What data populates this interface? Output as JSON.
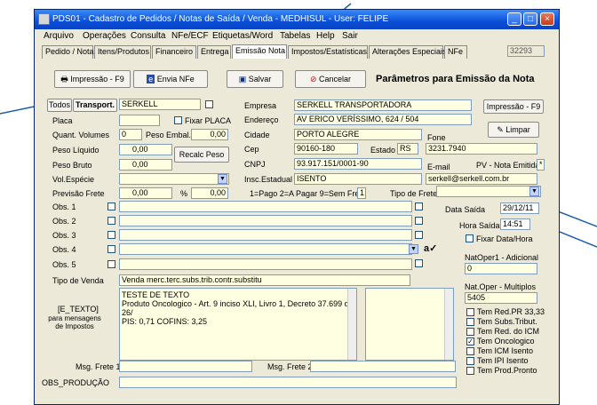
{
  "window": {
    "title": "PDS01 - Cadastro de Pedidos / Notas de Saída / Venda - MEDHISUL - User: FELIPE",
    "controls": {
      "minimize": "_",
      "maximize": "□",
      "close": "×"
    }
  },
  "menu": [
    "Arquivo",
    "Operações",
    "Consulta",
    "NFe/ECF",
    "Etiquetas/Word",
    "Tabelas",
    "Help",
    "Sair"
  ],
  "tabs": [
    "Pedido / Nota",
    "Itens/Produtos",
    "Financeiro",
    "Entrega",
    "Emissão Nota",
    "Impostos/Estatísticas",
    "Alterações Especiais",
    "NFe"
  ],
  "record_number": "32293",
  "toolbar": {
    "print": "Impressão - F9",
    "send_nfe": "Envia NFe",
    "save": "Salvar",
    "cancel": "Cancelar",
    "heading": "Parâmetros para Emissão da Nota"
  },
  "left": {
    "todos": "Todos",
    "transport": "Transport.",
    "transport_value": "SERKELL",
    "placa": "Placa",
    "fixar_placa": "Fixar PLACA",
    "quant_volumes": "Quant. Volumes",
    "quant_value": "0",
    "peso_embal": "Peso Embal.",
    "peso_embal_value": "0,00",
    "peso_liquido": "Peso Líquido",
    "peso_liquido_value": "0,00",
    "peso_bruto": "Peso Bruto",
    "peso_bruto_value": "0,00",
    "recalc": "Recalc Peso",
    "vol_especie": "Vol.Espécie",
    "previsao_frete": "Previsão Frete",
    "previsao_value": "0,00",
    "pct": "%",
    "pct_value": "0,00"
  },
  "company": {
    "empresa": "Empresa",
    "empresa_value": "SERKELL TRANSPORTADORA",
    "endereco": "Endereço",
    "endereco_value": "AV ERICO VERÍSSIMO, 624 / 504",
    "cidade": "Cidade",
    "cidade_value": "PORTO ALEGRE",
    "cep": "Cep",
    "cep_value": "90160-180",
    "estado": "Estado",
    "estado_value": "RS",
    "fone": "Fone",
    "fone_value": "3231.7940",
    "cnpj": "CNPJ",
    "cnpj_value": "93.917.151/0001-90",
    "email": "E-mail",
    "nota_emitida": "PV - Nota Emitida",
    "nota_emitida_value": "*",
    "insc": "Insc.Estadual",
    "insc_value": "ISENTO",
    "email_value": "serkell@serkell.com.br"
  },
  "right_top": {
    "print": "Impressão - F9",
    "clean": "Limpar"
  },
  "frete": {
    "legend": "1=Pago  2=A Pagar  9=Sem Frete",
    "value": "1",
    "tipo_label": "Tipo de Frete"
  },
  "obs": [
    "Obs. 1",
    "Obs. 2",
    "Obs. 3",
    "Obs. 4",
    "Obs. 5"
  ],
  "dates": {
    "data_saida": "Data Saída",
    "data_value": "29/12/11",
    "hora_saida": "Hora Saída",
    "hora_value": "14:51",
    "fixar": "Fixar Data/Hora"
  },
  "natoper": {
    "adicional": "NatOper1 - Adicional",
    "adicional_value": "0",
    "multiplos": "Nat.Oper - Multiplos",
    "multiplos_value": "5405"
  },
  "venda": {
    "label": "Tipo de Venda",
    "value": "Venda merc.terc.subs.trib.contr.substitu"
  },
  "etexto": {
    "label": "[E_TEXTO]",
    "sub": "para mensagens de Impostos",
    "lines": [
      "TESTE DE TEXTO",
      "Produto Oncologico - Art. 9 inciso XLI, Livro 1, Decreto 37.699 de 26/",
      "PIS: 0,71 COFINS: 3,25"
    ]
  },
  "taxes": [
    {
      "label": "Tem Red.PR 33,33",
      "checked": false
    },
    {
      "label": "Tem Subs.Tribut.",
      "checked": false
    },
    {
      "label": "Tem Red. do ICM",
      "checked": false
    },
    {
      "label": "Tem Oncologico",
      "checked": true
    },
    {
      "label": "Tem ICM Isento",
      "checked": false
    },
    {
      "label": "Tem IPI Isento",
      "checked": false
    },
    {
      "label": "Tem Prod.Pronto",
      "checked": false
    }
  ],
  "bottom": {
    "msg_frete1": "Msg. Frete 1",
    "msg_frete2": "Msg. Frete 2",
    "obs_producao": "OBS_PRODUÇÃO"
  }
}
